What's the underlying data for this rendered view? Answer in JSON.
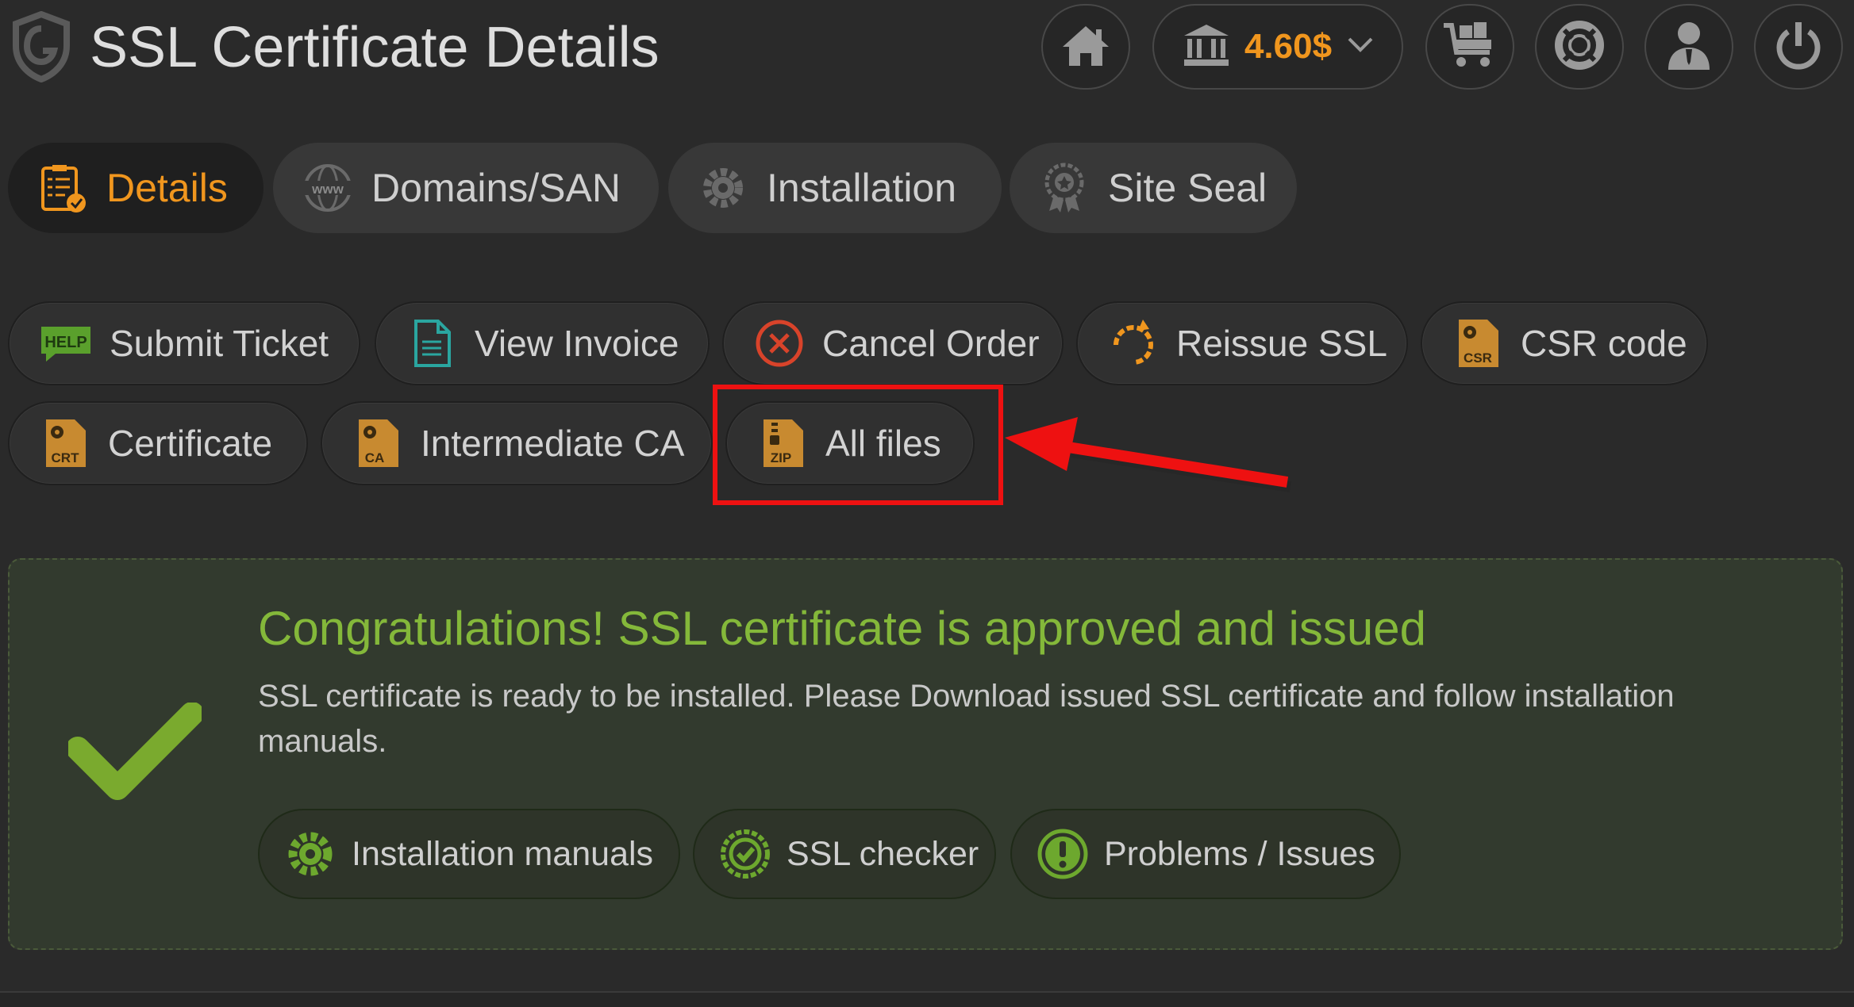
{
  "page": {
    "title": "SSL Certificate Details"
  },
  "topbar": {
    "balance": "4.60$",
    "icons": [
      "home-icon",
      "bank-icon",
      "chevron-down-icon",
      "cart-icon",
      "lifebuoy-icon",
      "user-icon",
      "power-icon"
    ]
  },
  "tabs": [
    {
      "label": "Details",
      "active": true
    },
    {
      "label": "Domains/SAN",
      "active": false
    },
    {
      "label": "Installation",
      "active": false
    },
    {
      "label": "Site Seal",
      "active": false
    }
  ],
  "actions": {
    "submit_ticket": "Submit Ticket",
    "help_badge": "HELP",
    "view_invoice": "View Invoice",
    "cancel_order": "Cancel Order",
    "reissue_ssl": "Reissue SSL",
    "csr_code": "CSR code",
    "csr_badge": "CSR",
    "certificate": "Certificate",
    "crt_badge": "CRT",
    "intermediate_ca": "Intermediate CA",
    "ca_badge": "CA",
    "all_files": "All files",
    "zip_badge": "ZIP"
  },
  "status": {
    "title": "Congratulations! SSL certificate is approved and issued",
    "text": "SSL certificate is ready to be installed. Please Download issued SSL certificate and follow installation manuals.",
    "buttons": {
      "manuals": "Installation manuals",
      "checker": "SSL checker",
      "problems": "Problems / Issues"
    }
  },
  "colors": {
    "accent": "#f0961e",
    "success": "#7aaa2e",
    "highlight": "#ee1111",
    "background": "#2a2a2a"
  }
}
